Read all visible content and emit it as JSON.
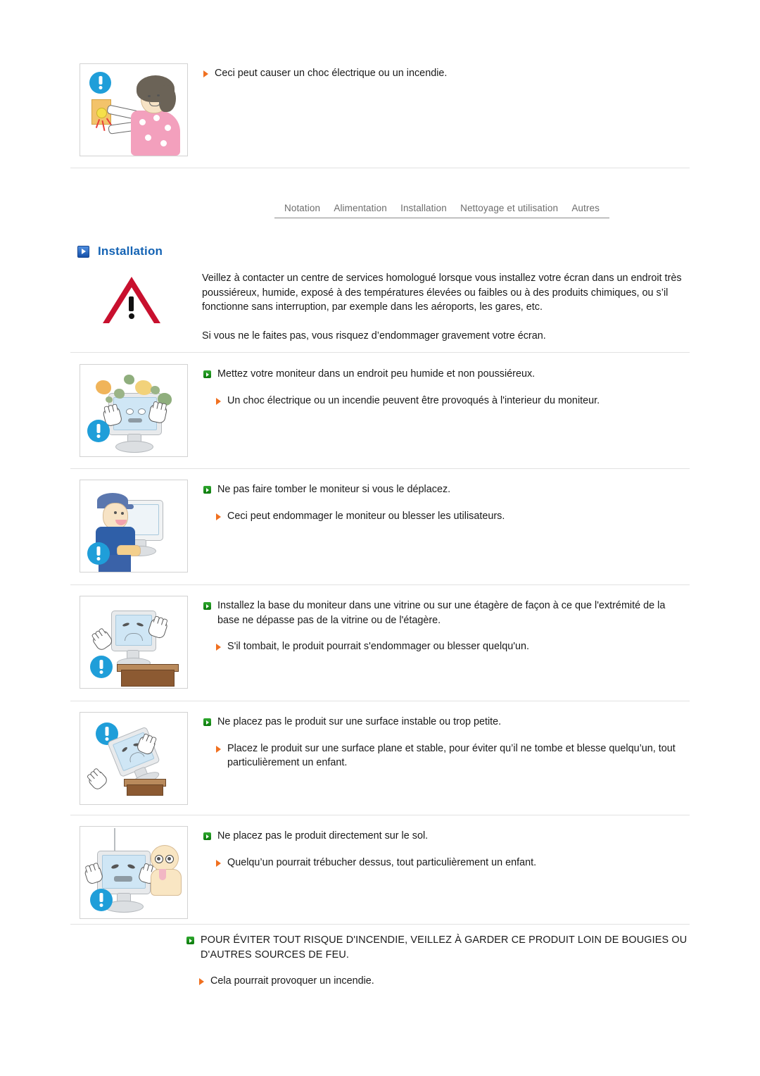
{
  "document": {
    "language": "fr",
    "heading": {
      "icon": "blue-arrow-icon",
      "title": "Installation"
    },
    "tabs": [
      {
        "label": "Notation"
      },
      {
        "label": "Alimentation"
      },
      {
        "label": "Installation"
      },
      {
        "label": "Nettoyage et utilisation"
      },
      {
        "label": "Autres"
      }
    ],
    "colors": {
      "heading_blue": "#1463b4",
      "green_marker": "#1a8a1a",
      "orange_marker": "#f07020",
      "warning_red": "#c8102e",
      "badge_blue": "#1f9ed9",
      "rule_grey": "#e2e2e2",
      "tab_text": "#6d6d6d"
    },
    "top_note": {
      "illustration": "woman-unplugging-socket-with-wet-hands",
      "bullet": "Ceci peut causer un choc électrique ou un incendie."
    },
    "intro": {
      "illustration": "red-warning-triangle",
      "paragraphs": [
        "Veillez à contacter un centre de services homologué lorsque vous installez votre écran dans un endroit très poussiéreux, humide, exposé à des températures élevées ou faibles ou à des produits chimiques, ou s’il fonctionne sans interruption, par exemple dans les aéroports, les gares, etc.",
        "Si vous ne le faites pas, vous risquez d’endommager gravement votre écran."
      ]
    },
    "sections": [
      {
        "illustration": "dusty-monitor-waving-hands",
        "main": "Mettez votre moniteur dans un endroit peu humide et non poussiéreux.",
        "sub": "Un choc électrique ou un incendie peuvent être provoqués à l'interieur du moniteur."
      },
      {
        "illustration": "man-carrying-monitor",
        "main": "Ne pas faire tomber le moniteur si vous le déplacez.",
        "sub": "Ceci peut endommager le moniteur ou blesser les utilisateurs."
      },
      {
        "illustration": "monitor-on-shelf-edge",
        "main": "Installez la base du moniteur dans une vitrine ou sur une étagère de façon à ce que l'extrémité de la base ne dépasse pas de la vitrine ou de l'étagère.",
        "sub": "S'il tombait, le produit pourrait s'endommager ou blesser quelqu'un."
      },
      {
        "illustration": "monitor-falling-off-small-table",
        "main": "Ne placez pas le produit sur une surface instable ou trop petite.",
        "sub": "Placez le produit sur une surface plane et stable, pour éviter qu’il ne tombe et blesse quelqu’un, tout particulièrement un enfant."
      },
      {
        "illustration": "monitor-on-floor-with-child",
        "main": "Ne placez pas le produit directement sur le sol.",
        "sub": "Quelqu’un pourrait trébucher dessus, tout particulièrement un enfant."
      }
    ],
    "final": {
      "main": "POUR ÉVITER TOUT RISQUE D'INCENDIE, VEILLEZ À GARDER CE PRODUIT LOIN DE BOUGIES OU D'AUTRES SOURCES DE FEU.",
      "sub": "Cela pourrait provoquer un incendie."
    }
  }
}
